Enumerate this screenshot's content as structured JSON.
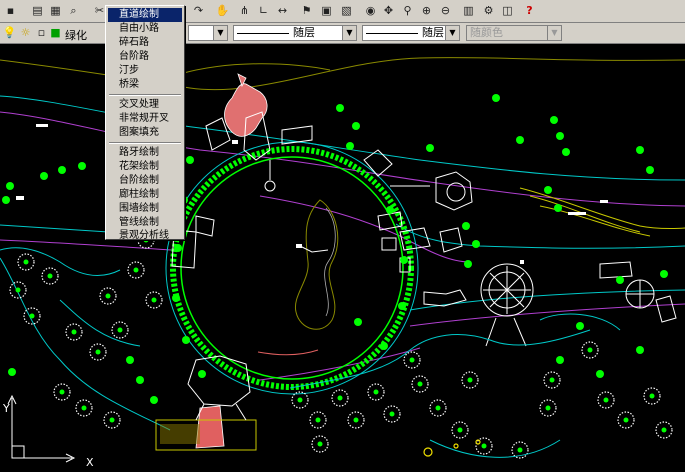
{
  "toolbar": {
    "icons": [
      "save-icon",
      "print-icon",
      "print-preview-icon",
      "find-icon",
      "cut-icon",
      "redo-icon",
      "pan-icon",
      "zoom-icon",
      "layer-icon",
      "properties-icon",
      "help-icon"
    ],
    "help_label": "?"
  },
  "layer_bar": {
    "layer_name": "绿化",
    "color_value": "",
    "linetype_value": "随层",
    "lineweight_value": "随层",
    "plotstyle_value": "随颜色"
  },
  "menu": {
    "groups": [
      [
        "直道绘制",
        "自由小路",
        "碎石路",
        "台阶路",
        "汀步",
        "桥梁"
      ],
      [
        "交叉处理",
        "非常规开叉",
        "图案填充"
      ],
      [
        "路牙绘制",
        "花架绘制",
        "台阶绘制",
        "廊柱绘制",
        "围墙绘制",
        "管线绘制",
        "景观分析线"
      ]
    ],
    "selected": "直道绘制"
  },
  "canvas": {
    "ucs_x_label": "X",
    "ucs_y_label": "Y",
    "colors": {
      "background": "#000000",
      "green": "#00ff00",
      "white": "#ffffff",
      "cyan": "#00c8c8",
      "magenta": "#b040d0",
      "red": "#e06060",
      "yellow": "#f0e000",
      "olive": "#c8c800"
    }
  }
}
